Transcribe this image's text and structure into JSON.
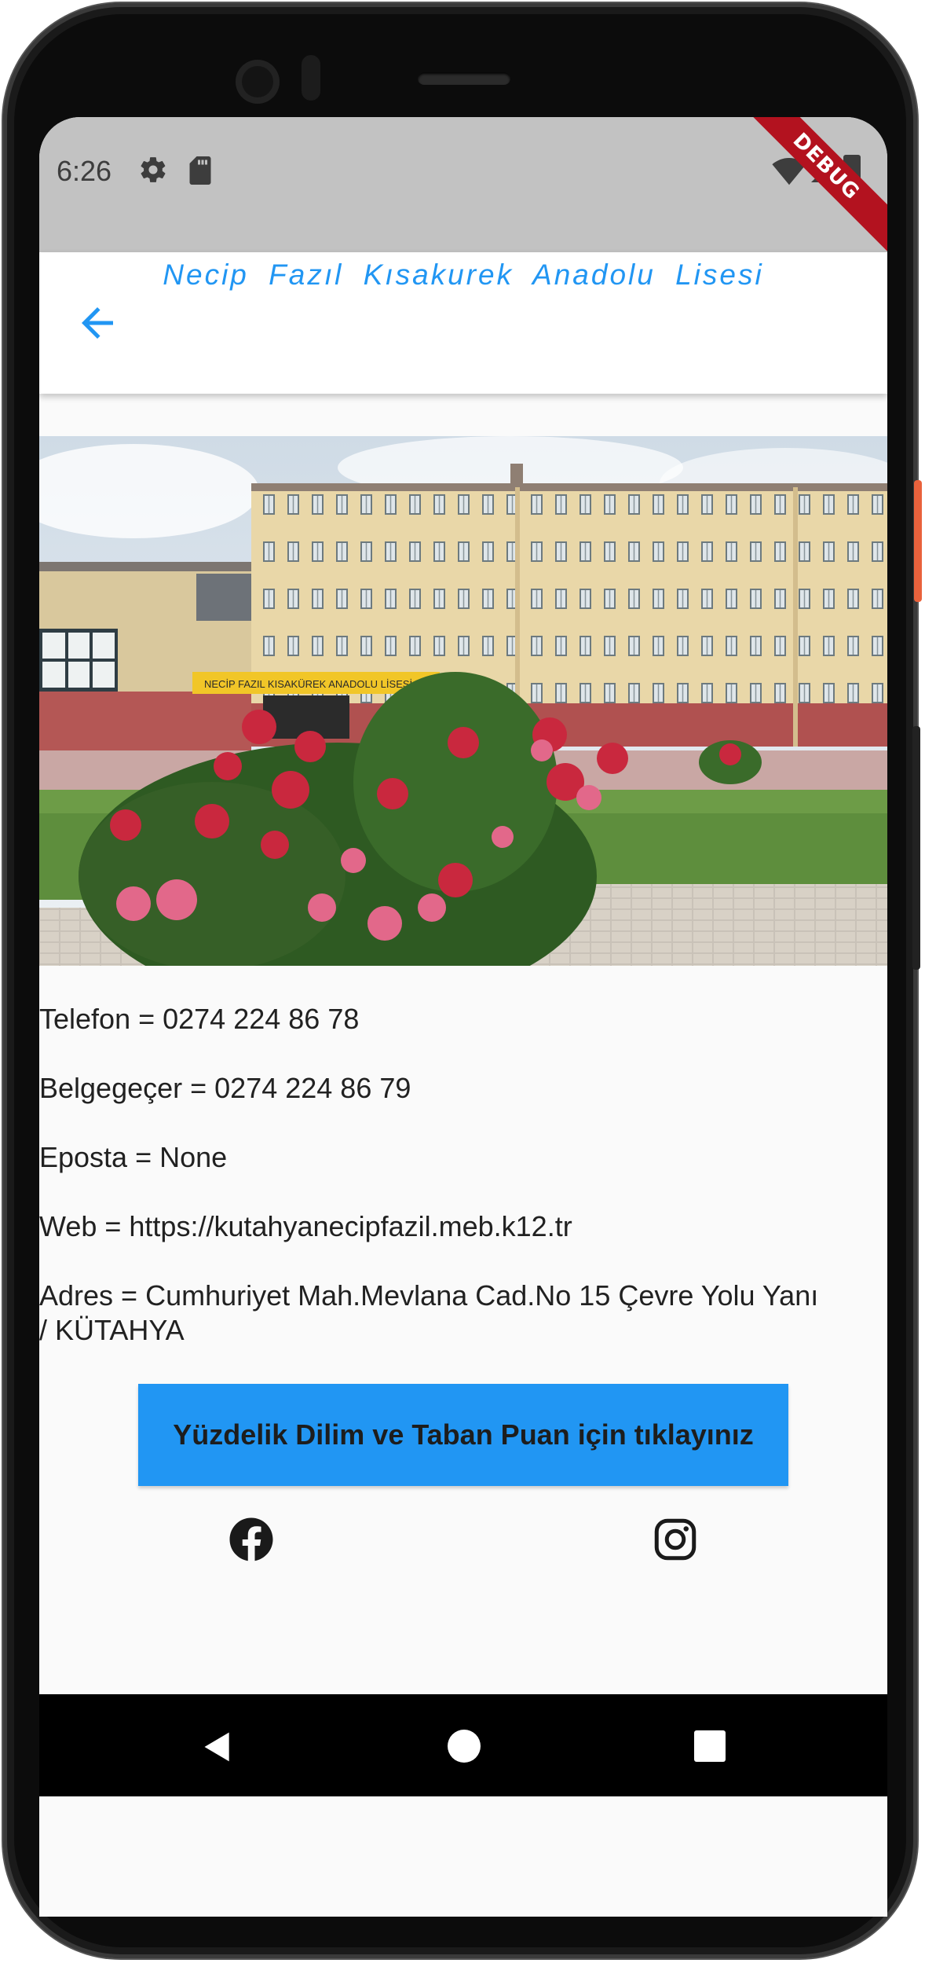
{
  "status_bar": {
    "time": "6:26",
    "debug_banner": "DEBUG"
  },
  "app_bar": {
    "title": "Necip  Fazıl  Kısakurek  Anadolu  Lisesi"
  },
  "school_photo": {
    "sign_text": "NECİP FAZIL KISAKÜREK ANADOLU LİSESİ"
  },
  "info": {
    "phone": "Telefon  =  0274 224 86 78",
    "fax": "Belgegeçer  =  0274 224 86 79",
    "email": "Eposta  =  None",
    "web": "Web  =  https://kutahyanecipfazil.meb.k12.tr",
    "address": "Adres  =  Cumhuriyet Mah.Mevlana Cad.No 15 Çevre Yolu Yanı / KÜTAHYA"
  },
  "cta_button": {
    "label": "Yüzdelik Dilim ve Taban Puan için tıklayınız"
  },
  "icons": {
    "back": "arrow-back-icon",
    "facebook": "facebook-icon",
    "instagram": "instagram-icon"
  },
  "colors": {
    "accent": "#2196f3",
    "status_bar": "#c2c2c2",
    "background": "#fafafa"
  }
}
